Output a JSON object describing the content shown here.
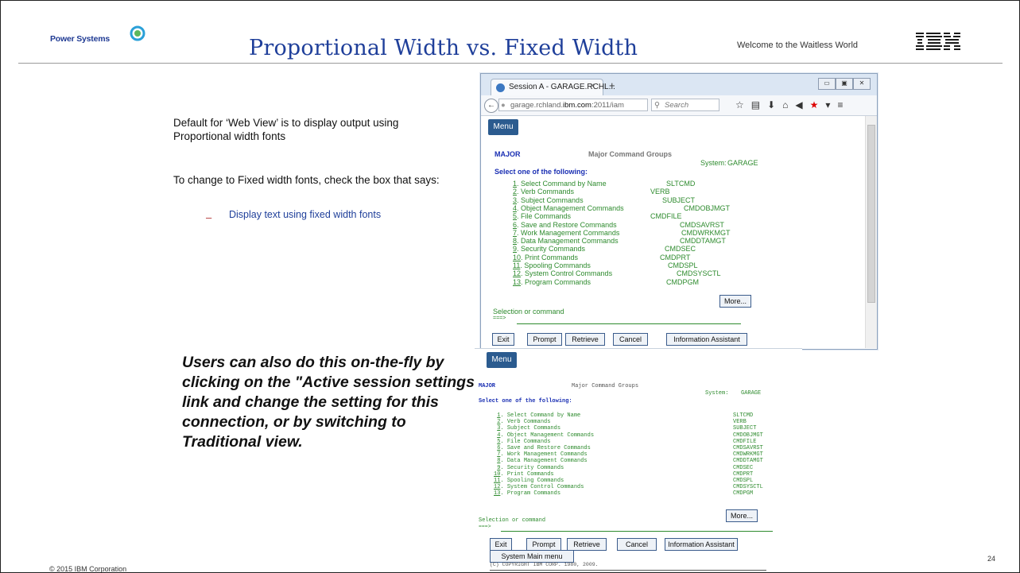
{
  "header": {
    "logo_text": "Power Systems",
    "title": "Proportional Width vs. Fixed Width",
    "tagline": "Welcome to the Waitless World",
    "ibm_logo": "IBM"
  },
  "body": {
    "para1": "Default for ‘Web View’ is to display output using Proportional width fonts",
    "para2": "To change to Fixed width fonts, check the box that says:",
    "bullet_dash": "–",
    "bullet": "Display text using fixed width fonts",
    "bold_note": "Users can also do this on-the-fly by clicking on the \"Active session settings\"  link and change the setting for this connection, or by switching to Traditional view."
  },
  "footer": {
    "copyright": "© 2015 IBM Corporation",
    "page_number": "24"
  },
  "browser": {
    "tab_label": "Session A - GARAGE.RCHL...",
    "tab_close": "×",
    "new_tab": "+",
    "url_prefix": "garage.rchland.",
    "url_domain": "ibm.com",
    "url_suffix": ":2011/iam",
    "search_placeholder": "Search",
    "win_min": "▭",
    "win_max": "▣",
    "win_close": "✕"
  },
  "session": {
    "menu_label": "Menu",
    "screen_id": "MAJOR",
    "screen_title": "Major Command Groups",
    "system_label": "System:",
    "system_name": "GARAGE",
    "prompt": "Select one of the following:",
    "options": [
      {
        "num": "1",
        "label": "Select Command by Name",
        "cmd": "SLTCMD"
      },
      {
        "num": "2",
        "label": "Verb Commands",
        "cmd": "VERB"
      },
      {
        "num": "3",
        "label": "Subject Commands",
        "cmd": "SUBJECT"
      },
      {
        "num": "4",
        "label": "Object Management Commands",
        "cmd": "CMDOBJMGT"
      },
      {
        "num": "5",
        "label": "File Commands",
        "cmd": "CMDFILE"
      },
      {
        "num": "6",
        "label": "Save and Restore Commands",
        "cmd": "CMDSAVRST"
      },
      {
        "num": "7",
        "label": "Work Management Commands",
        "cmd": "CMDWRKMGT"
      },
      {
        "num": "8",
        "label": "Data Management Commands",
        "cmd": "CMDDTAMGT"
      },
      {
        "num": "9",
        "label": "Security Commands",
        "cmd": "CMDSEC"
      },
      {
        "num": "10",
        "label": "Print Commands",
        "cmd": "CMDPRT"
      },
      {
        "num": "11",
        "label": "Spooling Commands",
        "cmd": "CMDSPL"
      },
      {
        "num": "12",
        "label": "System Control Commands",
        "cmd": "CMDSYSCTL"
      },
      {
        "num": "13",
        "label": "Program Commands",
        "cmd": "CMDPGM"
      }
    ],
    "more_label": "More...",
    "selection_label": "Selection or command",
    "input_arrow": "===>",
    "fkeys": [
      "Exit",
      "Prompt",
      "Retrieve",
      "Cancel",
      "Information Assistant"
    ],
    "system_main_menu": "System Main menu",
    "copyright_line": "(C) COPYRIGHT IBM CORP. 1980, 2009."
  },
  "colors": {
    "title_blue": "#1f3f9a",
    "green_link": "#2e8b2e",
    "menu_button": "#2b5b8f"
  }
}
